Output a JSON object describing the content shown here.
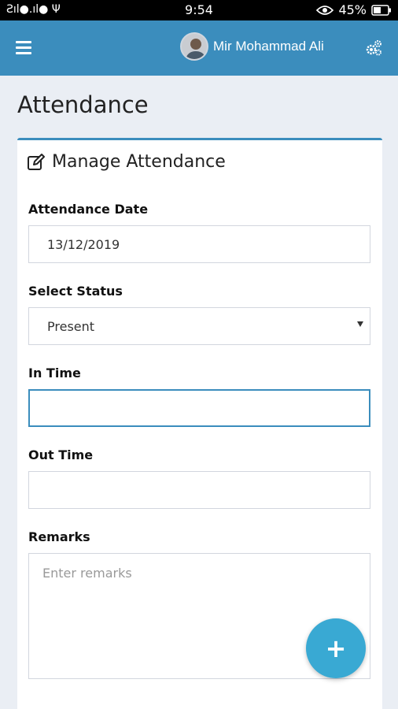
{
  "status_bar": {
    "left": "Ƨıl●.ıl● Ψ",
    "time": "9:54",
    "battery": "45%"
  },
  "header": {
    "user_name": "Mir Mohammad Ali"
  },
  "page": {
    "title": "Attendance"
  },
  "form": {
    "title": "Manage Attendance",
    "fields": {
      "attendance_date": {
        "label": "Attendance Date",
        "value": "13/12/2019"
      },
      "status": {
        "label": "Select Status",
        "value": "Present"
      },
      "in_time": {
        "label": "In Time",
        "value": ""
      },
      "out_time": {
        "label": "Out Time",
        "value": ""
      },
      "remarks": {
        "label": "Remarks",
        "placeholder": "Enter remarks"
      }
    }
  },
  "fab": {
    "label": "+"
  },
  "colors": {
    "primary": "#3b8dbd",
    "fab": "#39a9d3",
    "background": "#eaeef4"
  }
}
